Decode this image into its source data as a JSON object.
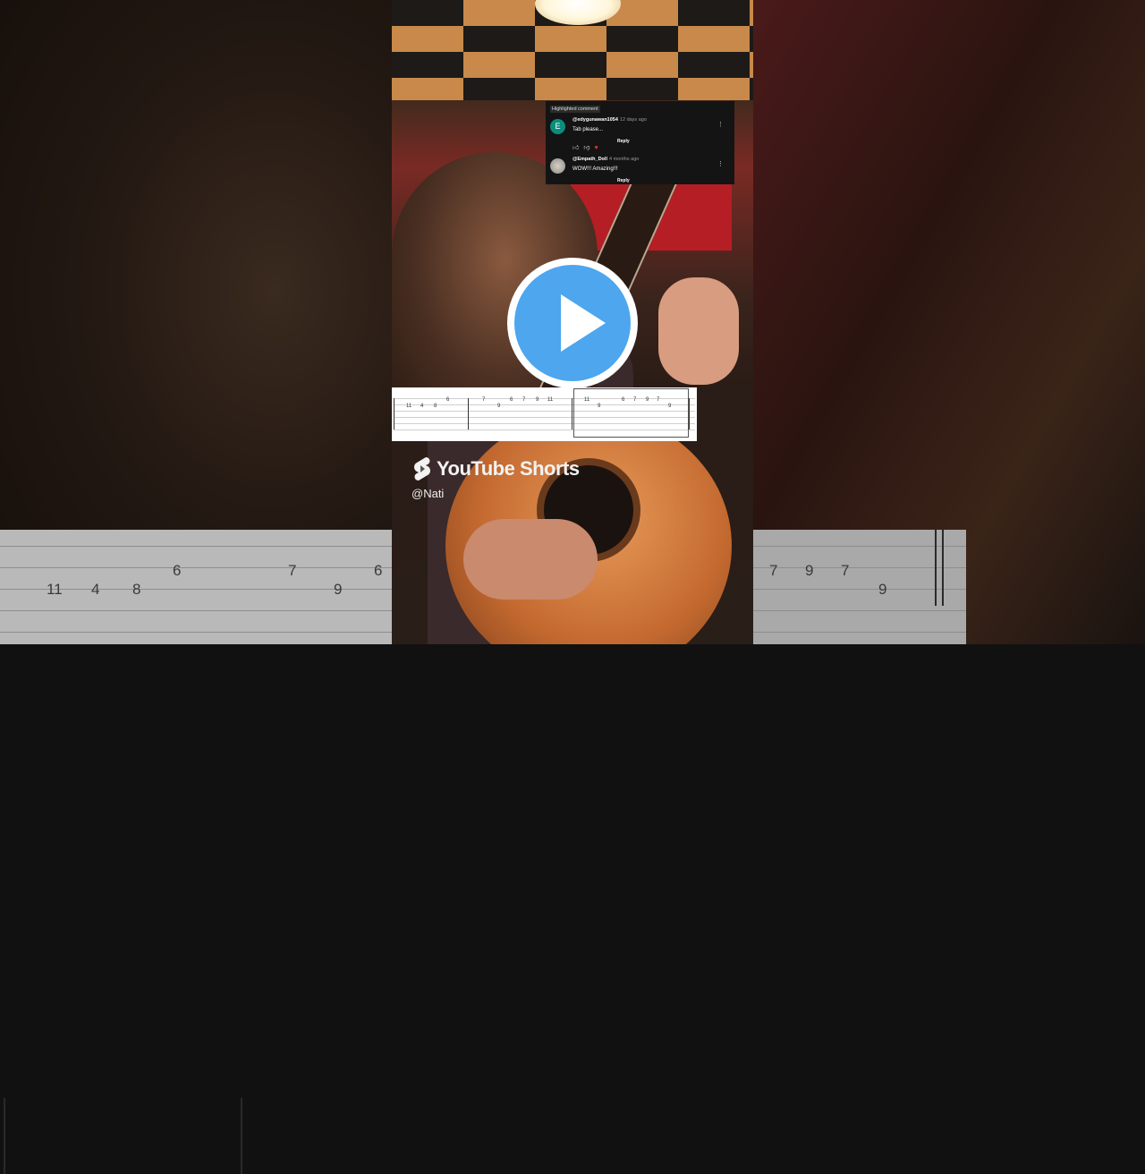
{
  "comments_overlay": {
    "highlight_label": "Highlighted comment",
    "comments": [
      {
        "avatar_letter": "E",
        "handle": "@edygunawan1054",
        "time": "12 days ago",
        "text": "Tab please...",
        "reply_label": "Reply"
      },
      {
        "avatar_letter": "",
        "handle": "@Empath_Doll",
        "time": "4 months ago",
        "text": "WOW!!! Amazing!!!",
        "reply_label": "Reply"
      }
    ]
  },
  "tab": {
    "numbers": [
      "11",
      "4",
      "8",
      "6",
      "7",
      "9",
      "6",
      "7",
      "9",
      "11",
      "11",
      "9",
      "6",
      "7",
      "9",
      "7",
      "9"
    ]
  },
  "background_tab": {
    "left_numbers": [
      "11",
      "4",
      "8",
      "6",
      "7",
      "9",
      "6"
    ],
    "right_numbers": [
      "7",
      "9",
      "7",
      "9"
    ]
  },
  "branding": {
    "logo_text": "YouTube Shorts",
    "channel": "@Nati"
  },
  "colors": {
    "play_button": "#4da6ee",
    "avatar_teal": "#0c8d7c"
  }
}
